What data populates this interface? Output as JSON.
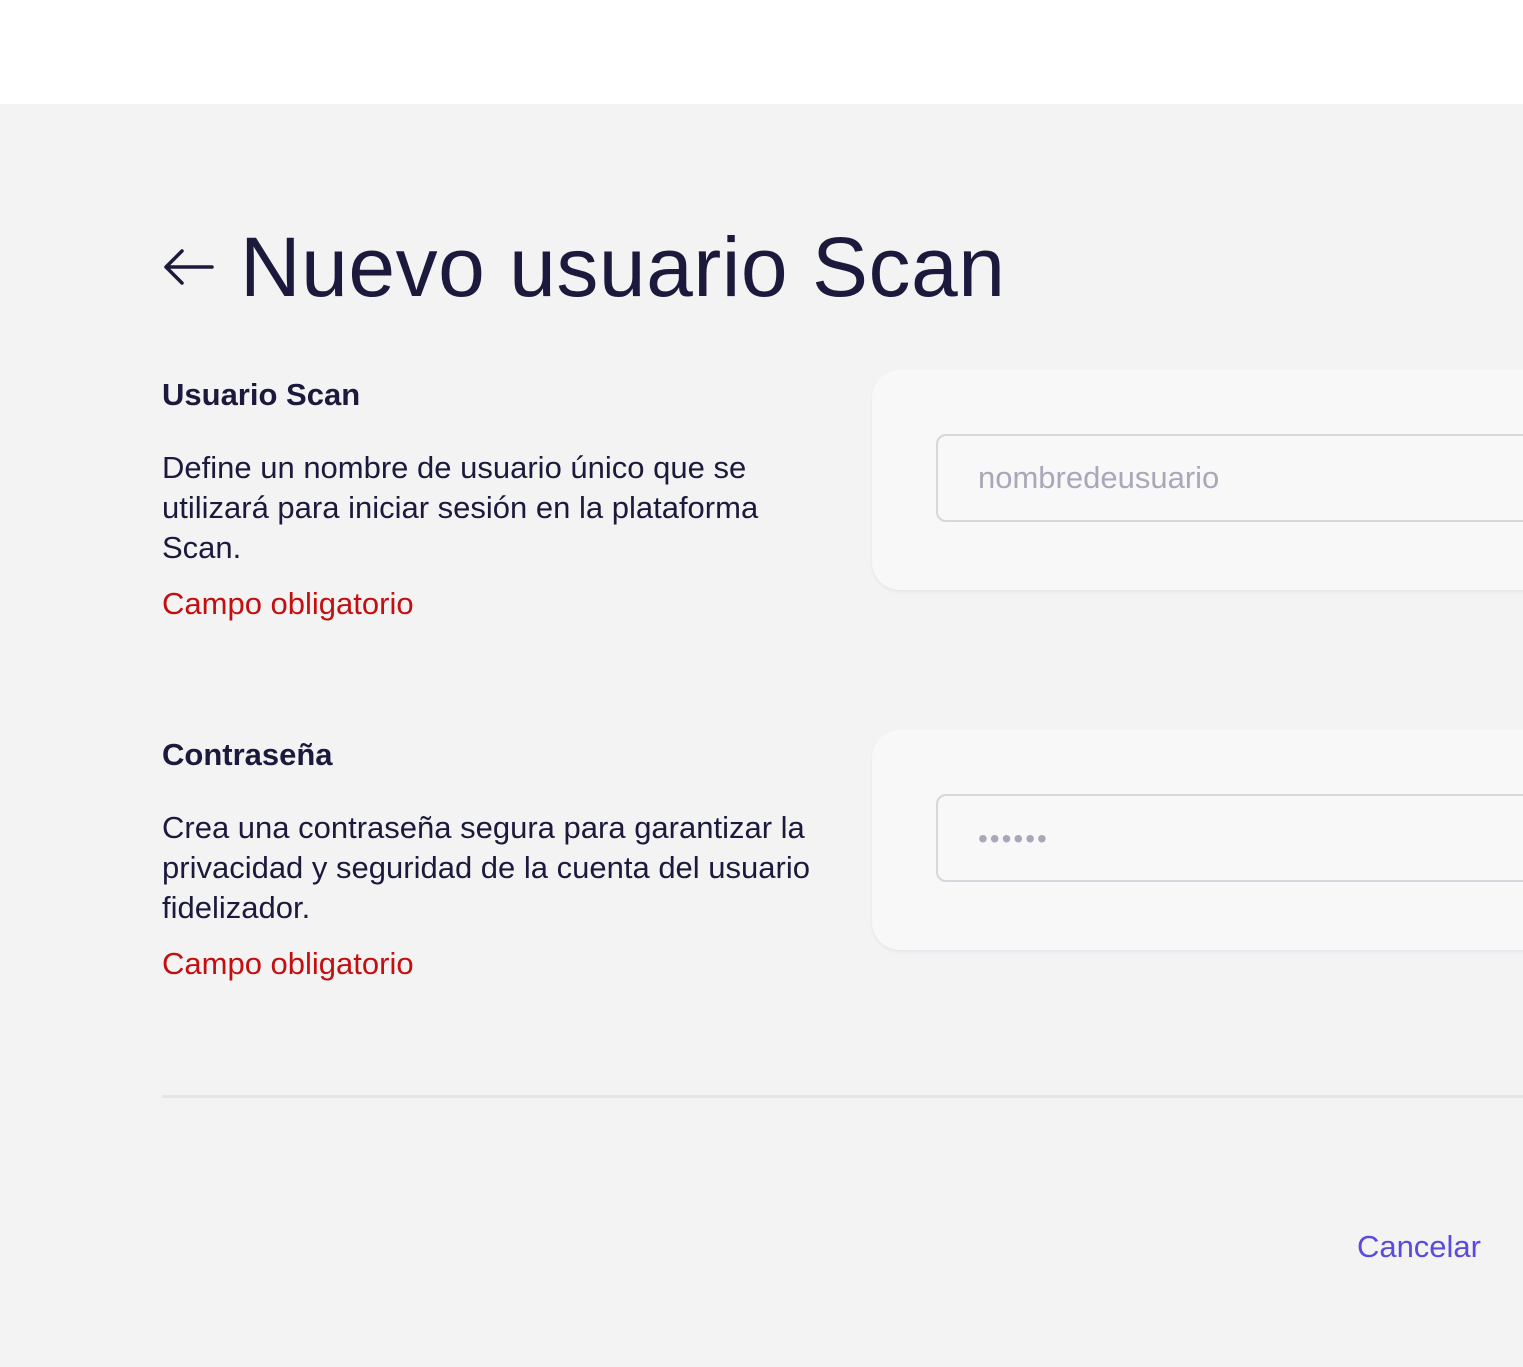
{
  "page": {
    "title": "Nuevo usuario Scan",
    "back_icon": "arrow-left-icon"
  },
  "sections": {
    "username": {
      "title": "Usuario Scan",
      "description": "Define un nombre de usuario único que se utilizará para iniciar sesión en la plataforma Scan.",
      "required_text": "Campo obligatorio",
      "placeholder": "nombredeusuario"
    },
    "password": {
      "title": "Contraseña",
      "description": "Crea una contraseña segura para garantizar la privacidad y seguridad de la cuenta del usuario fidelizador.",
      "required_text": "Campo obligatorio",
      "placeholder": "••••••"
    }
  },
  "footer": {
    "cancel_label": "Cancelar"
  },
  "colors": {
    "text": "#1c1a3c",
    "error": "#c30f0f",
    "link": "#5b4ae0",
    "background": "#f3f3f4",
    "card": "#f8f8f9"
  }
}
